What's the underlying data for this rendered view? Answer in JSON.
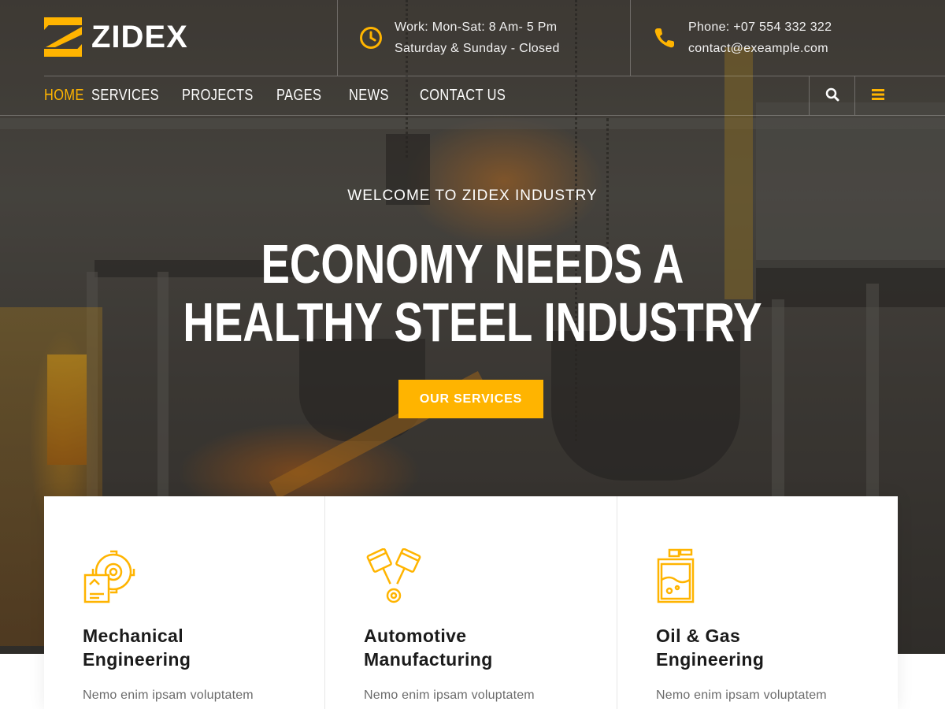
{
  "brand": {
    "name": "ZIDEX",
    "accent": "#ffb400"
  },
  "topbar": {
    "hours": {
      "icon": "clock-icon",
      "line1": "Work: Mon-Sat: 8 Am- 5 Pm",
      "line2": "Saturday & Sunday - Closed"
    },
    "contact": {
      "icon": "phone-icon",
      "line1": "Phone: +07 554 332 322",
      "line2": "contact@exeample.com"
    }
  },
  "nav": {
    "items": [
      {
        "label": "HOME",
        "active": true
      },
      {
        "label": "SERVICES"
      },
      {
        "label": "PROJECTS"
      },
      {
        "label": "PAGES"
      },
      {
        "label": "NEWS"
      },
      {
        "label": "CONTACT US"
      }
    ],
    "search_icon": "search-icon",
    "menu_icon": "hamburger-menu-icon"
  },
  "hero": {
    "kicker": "WELCOME TO ZIDEX INDUSTRY",
    "title_line1": "ECONOMY NEEDS A",
    "title_line2": "HEALTHY STEEL INDUSTRY",
    "cta": "OUR SERVICES"
  },
  "services": [
    {
      "icon": "gear-blueprint-icon",
      "title_line1": "Mechanical",
      "title_line2": "Engineering",
      "text": "Nemo enim ipsam voluptatem"
    },
    {
      "icon": "pistons-icon",
      "title_line1": "Automotive",
      "title_line2": "Manufacturing",
      "text": "Nemo enim ipsam voluptatem"
    },
    {
      "icon": "oil-canister-icon",
      "title_line1": "Oil & Gas",
      "title_line2": "Engineering",
      "text": "Nemo enim ipsam voluptatem"
    }
  ]
}
